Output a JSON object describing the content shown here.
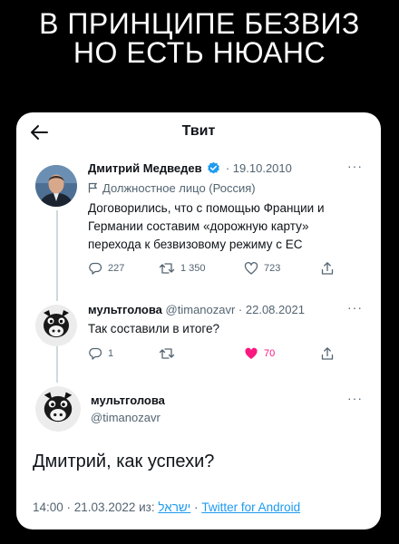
{
  "caption": {
    "line1": "В ПРИНЦИПЕ БЕЗВИЗ",
    "line2": "НО ЕСТЬ НЮАНС"
  },
  "header": {
    "title": "Твит"
  },
  "tweet1": {
    "name": "Дмитрий Медведев",
    "date": "· 19.10.2010",
    "label": "Должностное лицо (Россия)",
    "text_lines": [
      "Договорились, что с помощью Франции и",
      "Германии составим «дорожную карту»",
      "перехода к безвизовому режиму с ЕС"
    ],
    "replies": "227",
    "retweets": "1 350",
    "likes": "723"
  },
  "tweet2": {
    "name": "мультголова",
    "handle_date": "@timanozavr · 22.08.2021",
    "text": "Так составили в итоге?",
    "replies": "1",
    "likes": "70"
  },
  "tweet3": {
    "name": "мультголова",
    "handle": "@timanozavr",
    "text": "Дмитрий, как успехи?",
    "time_date": "14:00 · 21.03.2022 из:",
    "location": "ישראל",
    "separator": "·",
    "source": "Twitter for Android"
  },
  "colors": {
    "accent": "#1d9bf0",
    "like_active": "#f91880",
    "text": "#0f1419",
    "secondary": "#536471"
  },
  "icons": {
    "back": "arrow-left-icon",
    "verified": "verified-badge-icon",
    "label": "flag-icon",
    "more": "more-icon",
    "reply": "reply-icon",
    "retweet": "retweet-icon",
    "like": "heart-icon",
    "share": "share-icon"
  }
}
